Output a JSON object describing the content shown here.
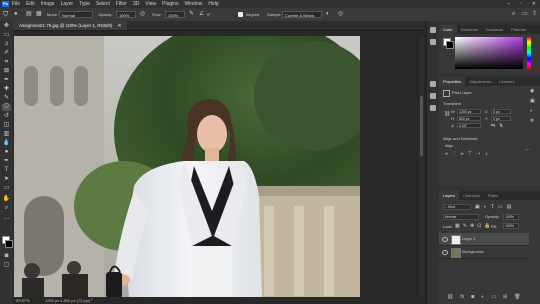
{
  "app": {
    "logo": "Ps",
    "brand_color": "#1473e6"
  },
  "menubar": {
    "items": [
      "File",
      "Edit",
      "Image",
      "Layer",
      "Type",
      "Select",
      "Filter",
      "3D",
      "View",
      "Plugins",
      "Window",
      "Help"
    ]
  },
  "options": {
    "mode_label": "Mode:",
    "mode_value": "Normal",
    "opacity_label": "Opacity:",
    "opacity_value": "100%",
    "flow_label": "Flow:",
    "flow_value": "100%",
    "angle_value": "0°",
    "aligned_label": "Aligned",
    "sample_value": "Current & Below"
  },
  "document": {
    "tab_title": "Assignment1.75.jpg @ 100% (Layer 1, RGB/8)",
    "zoom": "99.87%",
    "size_info": "1200 px x 800 px (72 ppi)"
  },
  "color_panel": {
    "tabs": [
      "Color",
      "Swatches",
      "Gradients",
      "Patterns"
    ]
  },
  "properties_panel": {
    "tabs": [
      "Properties",
      "Adjustments",
      "Libraries"
    ],
    "layer_type": "Pixel Layer",
    "transform_label": "Transform",
    "w_label": "W",
    "w_value": "1200 px",
    "h_label": "H",
    "h_value": "800 px",
    "x_value": "0 px",
    "y_value": "0 px",
    "angle_value": "0.00°",
    "align_label": "Align and Distribute",
    "align_sub": "Align:"
  },
  "layers_panel": {
    "tabs": [
      "Layers",
      "Channels",
      "Paths"
    ],
    "kind_label": "Kind",
    "blend_mode": "Normal",
    "opacity_label": "Opacity:",
    "opacity_value": "100%",
    "lock_label": "Lock:",
    "fill_label": "Fill:",
    "fill_value": "100%",
    "layers": [
      {
        "name": "Layer 1",
        "selected": true
      },
      {
        "name": "Background",
        "selected": false
      }
    ]
  }
}
